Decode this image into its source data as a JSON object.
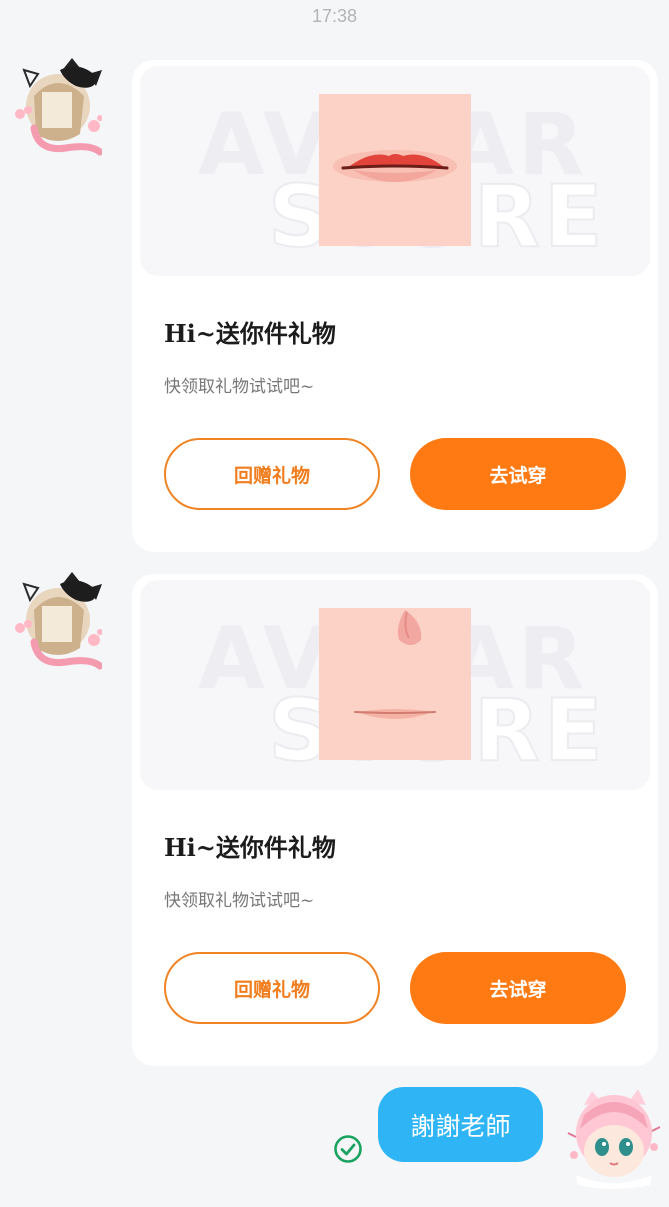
{
  "status": {
    "time": "17:38"
  },
  "watermark": {
    "line1": "AVATAR",
    "line2": "STORE"
  },
  "messages": [
    {
      "title": "Hi~送你件礼物",
      "description": "快领取礼物试试吧~",
      "return_gift_label": "回赠礼物",
      "try_on_label": "去试穿",
      "item": "lips"
    },
    {
      "title": "Hi~送你件礼物",
      "description": "快领取礼物试试吧~",
      "return_gift_label": "回赠礼物",
      "try_on_label": "去试穿",
      "item": "nose-and-lips"
    }
  ],
  "reply": {
    "text": "謝謝老師",
    "status_icon": "check-circle-icon"
  },
  "colors": {
    "accent": "#ff7a12",
    "bubble": "#2fb5f5",
    "check": "#1aa260"
  }
}
